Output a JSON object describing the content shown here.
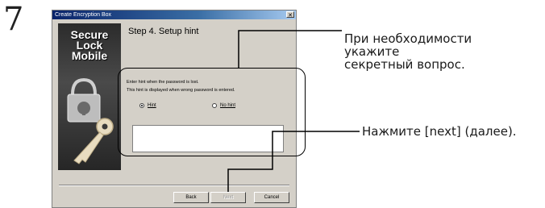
{
  "step_number": "7",
  "dialog": {
    "title": "Create Encryption Box",
    "close_glyph": "✕",
    "brand": [
      "Secure",
      "Lock",
      "Mobile"
    ],
    "step_title": "Step 4. Setup hint",
    "instruction_1": "Enter hint when the password is lost.",
    "instruction_2": "This hint is displayed when wrong password is entered.",
    "radio_hint": {
      "label": "Hint",
      "selected": true
    },
    "radio_no_hint": {
      "label": "No hint",
      "selected": false
    },
    "hint_value": "",
    "buttons": {
      "back": "Back",
      "next": "Next",
      "cancel": "Cancel"
    }
  },
  "annotations": {
    "hint_note": [
      "При необходимости",
      "укажите",
      "секретный вопрос."
    ],
    "next_note": "Нажмите [next] (далее)."
  },
  "icons": [
    "padlock-icon",
    "key-icon",
    "close-icon"
  ]
}
